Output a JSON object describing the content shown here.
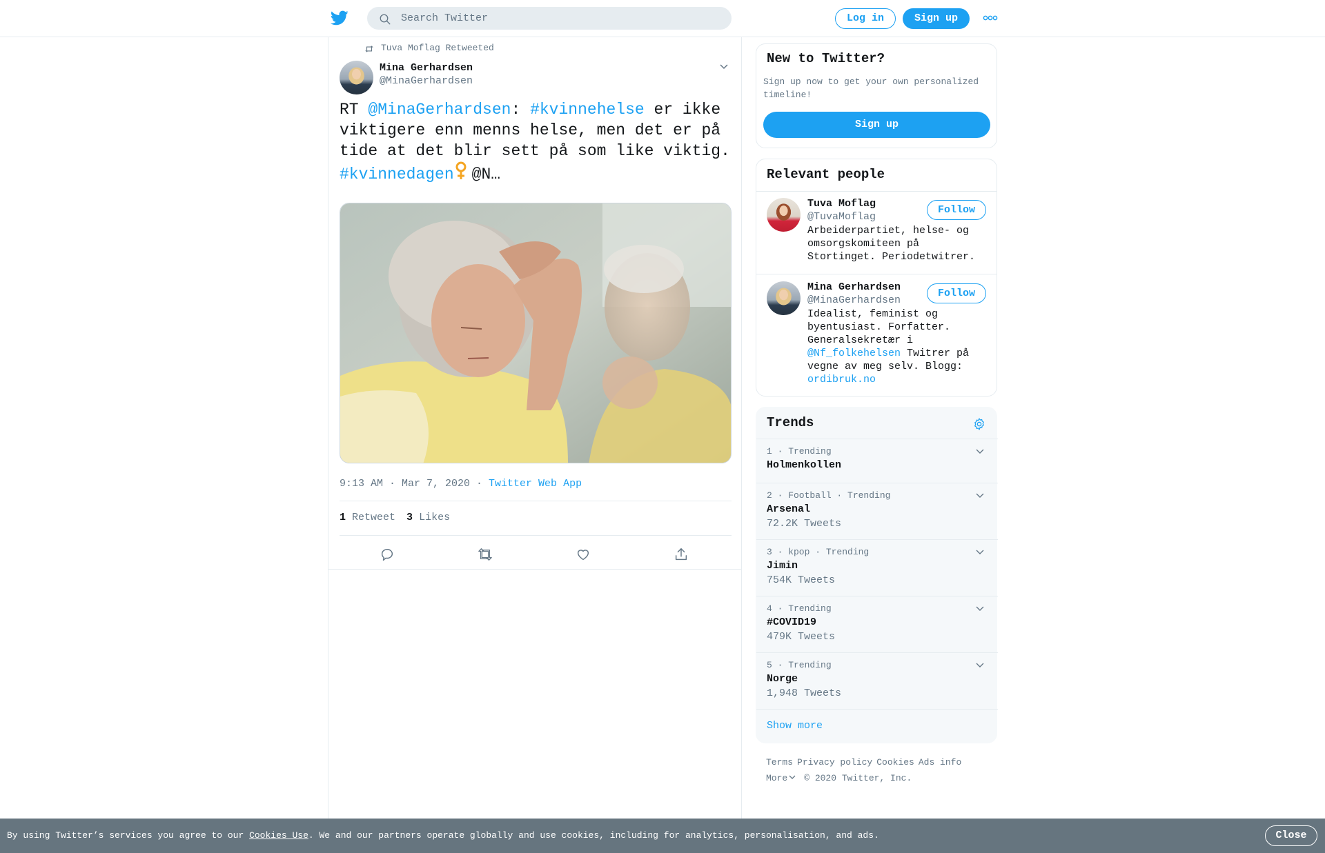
{
  "header": {
    "logo": "twitter-bird-icon",
    "search_placeholder": "Search Twitter",
    "login_label": "Log in",
    "signup_label": "Sign up",
    "more_icon": "more-dots-icon"
  },
  "tweet": {
    "retweeted_by": "Tuva Moflag Retweeted",
    "author_name": "Mina Gerhardsen",
    "author_handle": "@MinaGerhardsen",
    "text": {
      "rt_prefix": "RT ",
      "mention": "@MinaGerhardsen",
      "colon": ": ",
      "hashtag1": "#kvinnehelse",
      "line1_rest": " er ikke",
      "line2": "viktigere enn menns helse, men det er på",
      "line3": "tide at det blir sett på som like viktig.",
      "hashtag2": "#kvinnedagen",
      "emoji": "female-sign-icon",
      "trail": "@N…"
    },
    "timestamp": "9:13 AM · Mar 7, 2020",
    "separator": " · ",
    "source": "Twitter Web App",
    "retweet_count": "1",
    "retweet_label": "Retweet",
    "like_count": "3",
    "like_label": "Likes",
    "actions": [
      "reply-icon",
      "retweet-icon",
      "like-icon",
      "share-icon"
    ]
  },
  "new_to_twitter": {
    "title": "New to Twitter?",
    "description": "Sign up now to get your own personalized timeline!",
    "signup_label": "Sign up"
  },
  "relevant_people": {
    "title": "Relevant people",
    "people": [
      {
        "name": "Tuva Moflag",
        "handle": "@TuvaMoflag",
        "follow_label": "Follow",
        "bio_lines": [
          "Arbeiderpartiet, helse- og",
          "omsorgskomiteen på",
          "Stortinget. Periodetwitrer."
        ]
      },
      {
        "name": "Mina Gerhardsen",
        "handle": "@MinaGerhardsen",
        "follow_label": "Follow",
        "bio_lines": [
          "Idealist, feminist og",
          "byentusiast. Forfatter.",
          "Generalsekretær i"
        ],
        "bio_link": "@Nf_folkehelsen",
        "bio_after_link": " Twitrer på",
        "bio_line5": "vegne av meg selv. Blogg:",
        "bio_url": "ordibruk.no"
      }
    ]
  },
  "trends": {
    "title": "Trends",
    "settings_icon": "gear-icon",
    "items": [
      {
        "meta": "1 · Trending",
        "name": "Holmenkollen",
        "count": ""
      },
      {
        "meta": "2 · Football · Trending",
        "name": "Arsenal",
        "count": "72.2K Tweets"
      },
      {
        "meta": "3 · kpop · Trending",
        "name": "Jimin",
        "count": "754K Tweets"
      },
      {
        "meta": "4 · Trending",
        "name": "#COVID19",
        "count": "479K Tweets"
      },
      {
        "meta": "5 · Trending",
        "name": "Norge",
        "count": "1,948 Tweets"
      }
    ],
    "show_more": "Show more"
  },
  "footer": {
    "links": [
      "Terms",
      "Privacy policy",
      "Cookies",
      "Ads info"
    ],
    "more": "More",
    "copyright": "© 2020 Twitter, Inc."
  },
  "cookie_banner": {
    "prefix": "By using Twitter’s services you agree to our ",
    "link": "Cookies Use",
    "suffix": ". We and our partners operate globally and use cookies, including for analytics, personalisation, and ads.",
    "close_label": "Close"
  },
  "colors": {
    "brand": "#1da1f2",
    "text": "#14171a",
    "muted": "#657786",
    "divider": "#e6ecf0",
    "banner": "#66757f",
    "emoji": "#f4a522"
  }
}
